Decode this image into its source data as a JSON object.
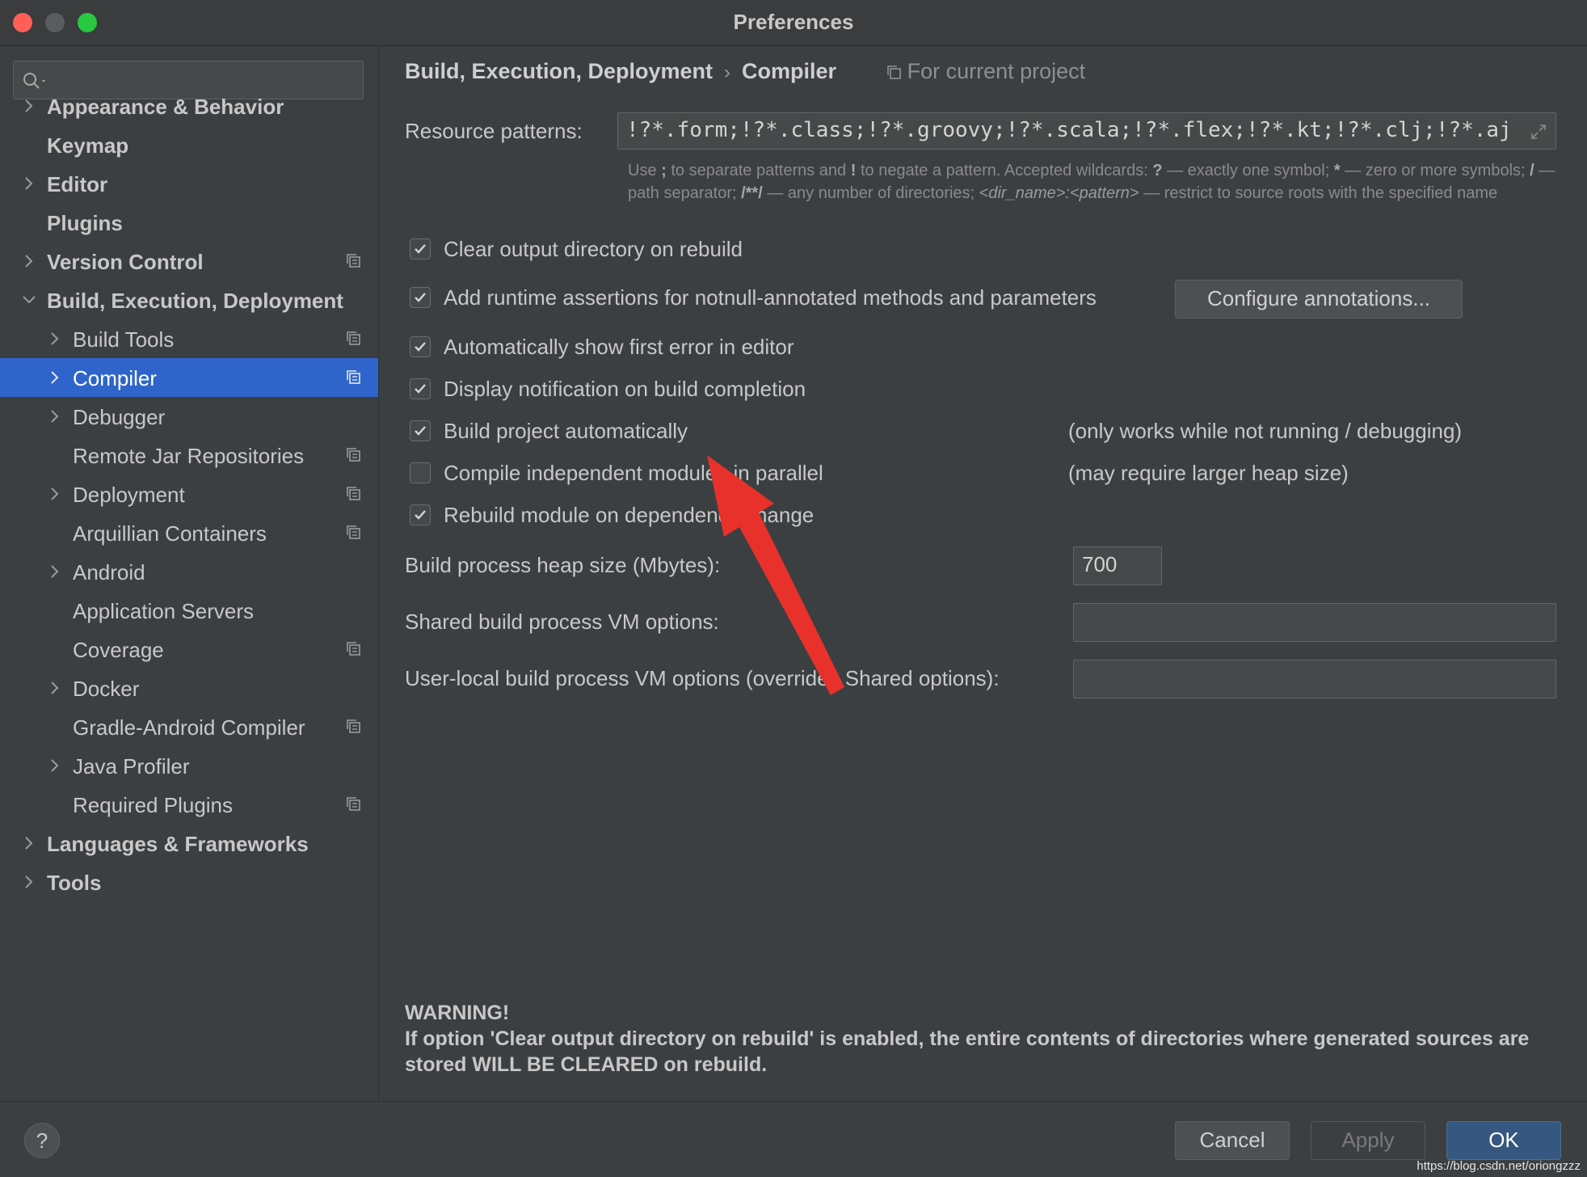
{
  "window": {
    "title": "Preferences"
  },
  "search": {
    "placeholder": ""
  },
  "sidebar": {
    "items": [
      {
        "label": "Appearance & Behavior"
      },
      {
        "label": "Keymap"
      },
      {
        "label": "Editor"
      },
      {
        "label": "Plugins"
      },
      {
        "label": "Version Control"
      },
      {
        "label": "Build, Execution, Deployment"
      },
      {
        "label": "Build Tools"
      },
      {
        "label": "Compiler"
      },
      {
        "label": "Debugger"
      },
      {
        "label": "Remote Jar Repositories"
      },
      {
        "label": "Deployment"
      },
      {
        "label": "Arquillian Containers"
      },
      {
        "label": "Android"
      },
      {
        "label": "Application Servers"
      },
      {
        "label": "Coverage"
      },
      {
        "label": "Docker"
      },
      {
        "label": "Gradle-Android Compiler"
      },
      {
        "label": "Java Profiler"
      },
      {
        "label": "Required Plugins"
      },
      {
        "label": "Languages & Frameworks"
      },
      {
        "label": "Tools"
      }
    ]
  },
  "breadcrumb": {
    "parent": "Build, Execution, Deployment",
    "current": "Compiler",
    "project_hint": "For current project"
  },
  "resource_patterns": {
    "label": "Resource patterns:",
    "value": "!?*.form;!?*.class;!?*.groovy;!?*.scala;!?*.flex;!?*.kt;!?*.clj;!?*.aj"
  },
  "hint": {
    "p1": "Use ",
    "sym1": ";",
    "p2": " to separate patterns and ",
    "sym2": "!",
    "p3": " to negate a pattern. Accepted wildcards: ",
    "sym3": "?",
    "p4": " — exactly one symbol; ",
    "sym4": "*",
    "p5": " — zero or more symbols; ",
    "sym5": "/",
    "p6": " — path separator; ",
    "sym6": "/**/",
    "p7": " — any number of directories; ",
    "sym7": "<dir_name>:<pattern>",
    "p8": " — restrict to source roots with the specified name"
  },
  "options": {
    "clear_output": {
      "label": "Clear output directory on rebuild",
      "checked": true
    },
    "runtime_assertions": {
      "label": "Add runtime assertions for notnull-annotated methods and parameters",
      "checked": true
    },
    "show_first_error": {
      "label": "Automatically show first error in editor",
      "checked": true
    },
    "display_notification": {
      "label": "Display notification on build completion",
      "checked": true
    },
    "build_automatically": {
      "label": "Build project automatically",
      "checked": true,
      "note": "(only works while not running / debugging)"
    },
    "compile_parallel": {
      "label": "Compile independent modules in parallel",
      "checked": false,
      "note": "(may require larger heap size)"
    },
    "rebuild_on_dependency": {
      "label": "Rebuild module on dependency change",
      "checked": true
    }
  },
  "configure_annotations_button": "Configure annotations...",
  "heap": {
    "label": "Build process heap size (Mbytes):",
    "value": "700"
  },
  "shared_vm": {
    "label": "Shared build process VM options:",
    "value": ""
  },
  "user_vm": {
    "label": "User-local build process VM options (overrides Shared options):",
    "value": ""
  },
  "warning": {
    "title": "WARNING!",
    "text": "If option 'Clear output directory on rebuild' is enabled, the entire contents of directories where generated sources are stored WILL BE CLEARED on rebuild."
  },
  "footer": {
    "help": "?",
    "cancel": "Cancel",
    "apply": "Apply",
    "ok": "OK",
    "watermark": "https://blog.csdn.net/oriongzzz"
  },
  "colors": {
    "selection": "#2f65ca",
    "annotation_arrow": "#e8312b",
    "ok_button": "#365880"
  }
}
